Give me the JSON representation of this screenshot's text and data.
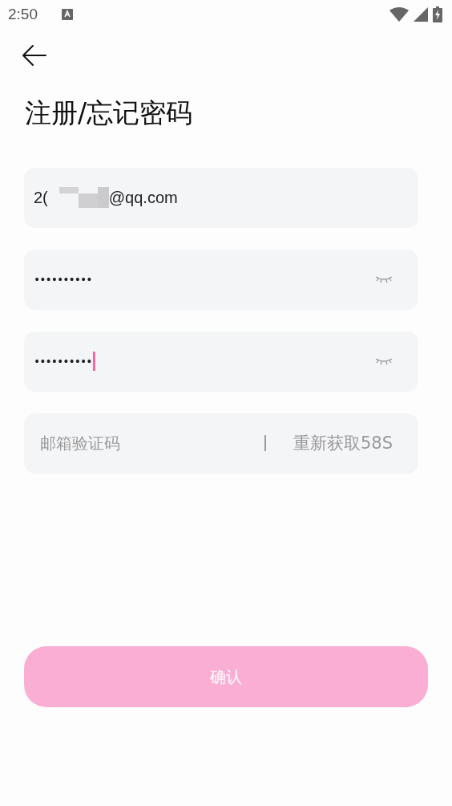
{
  "status_bar": {
    "time": "2:50"
  },
  "title": "注册/忘记密码",
  "email_field": {
    "value_start": "2(",
    "redacted": true,
    "value_end": "@qq.com"
  },
  "password_fields": [
    {
      "value": "••••••••••",
      "focused": false,
      "visible": false
    },
    {
      "value": "••••••••••",
      "focused": true,
      "visible": false
    }
  ],
  "code_field": {
    "placeholder": "邮箱验证码",
    "resend": "重新获取58S"
  },
  "confirm_button": {
    "label": "确认",
    "disabled": true
  }
}
